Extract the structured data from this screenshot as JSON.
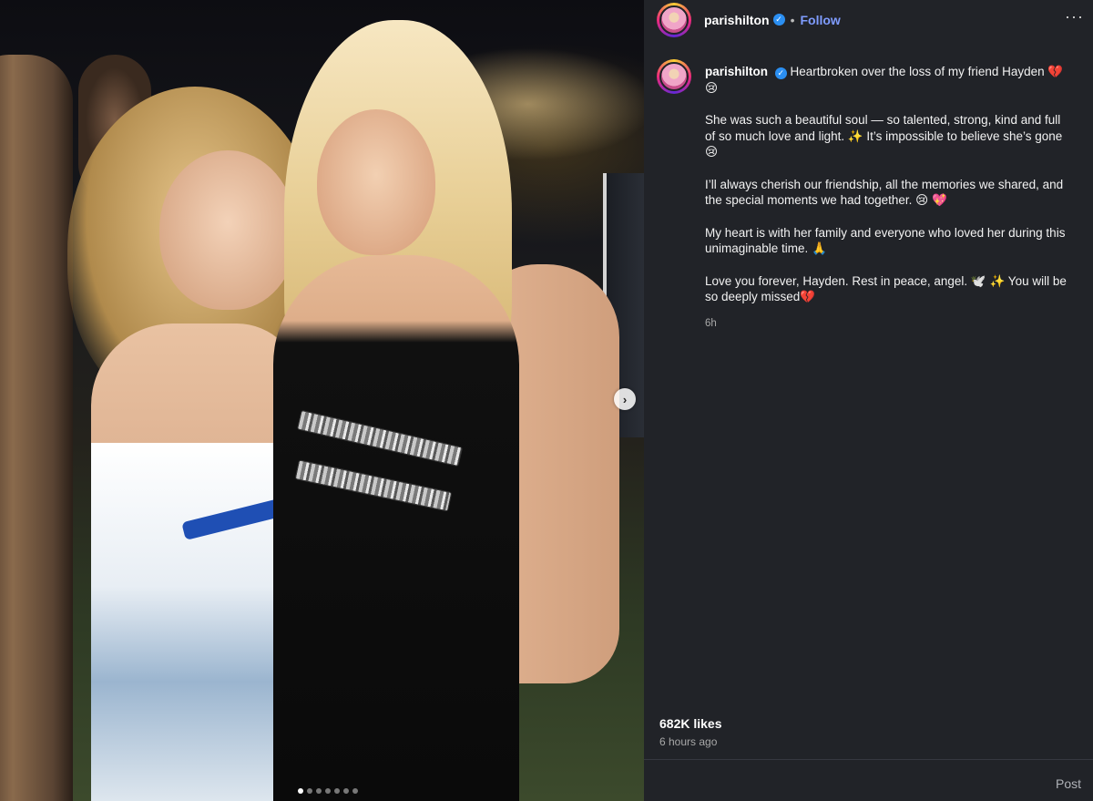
{
  "post": {
    "username": "parishilton",
    "follow_label": "Follow",
    "separator": "•",
    "more_label": "···",
    "caption_paragraphs": [
      "Heartbroken over the loss of my friend Hayden 💔 😢",
      "She was such a beautiful soul — so talented, strong, kind and full of so much love and light. ✨ It’s impossible to believe she’s gone😢",
      "I’ll always cherish our friendship, all the memories we shared, and the special moments we had together. 😢 💖",
      "My heart is with her family and everyone who loved her during this unimaginable time. 🙏",
      "Love you forever, Hayden. Rest in peace, angel. 🕊️ ✨ You will be so deeply missed💔"
    ],
    "caption_time": "6h",
    "likes": "682K likes",
    "posted_ago": "6 hours ago",
    "comment_placeholder": "",
    "post_button": "Post",
    "next_arrow": "›"
  },
  "carousel": {
    "total": 7,
    "active": 1
  },
  "colors": {
    "panel_bg": "#212328",
    "follow_blue": "#7f9cff",
    "verified_blue": "#2b8ff2",
    "muted_text": "#a8a8a8"
  },
  "icons": {
    "verified": "verified-badge-icon",
    "more": "more-options-icon",
    "next": "chevron-right-icon"
  }
}
